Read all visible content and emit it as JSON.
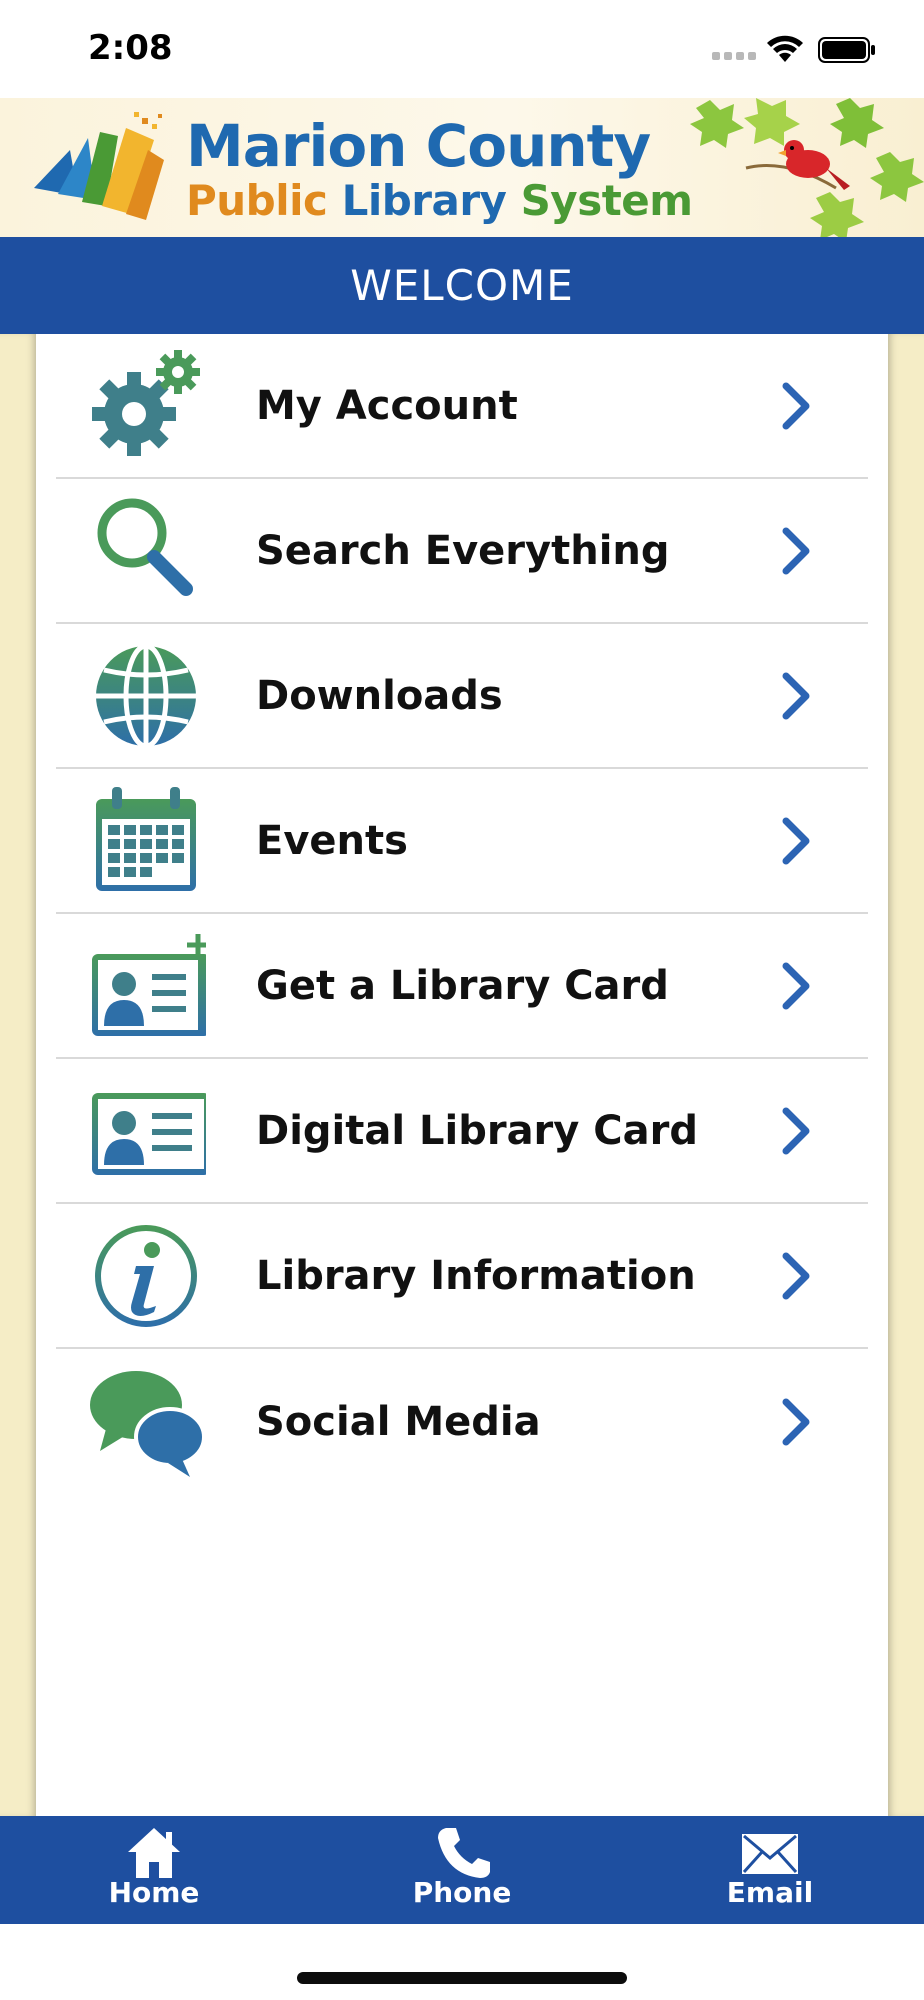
{
  "status_bar": {
    "time": "2:08"
  },
  "header": {
    "logo_line1": "Marion County",
    "logo_line2_word1": "Public",
    "logo_line2_word2": "Library",
    "logo_line2_word3": "System"
  },
  "welcome": {
    "title": "WELCOME"
  },
  "menu": {
    "items": [
      {
        "label": "My Account",
        "icon": "gears-icon"
      },
      {
        "label": "Search Everything",
        "icon": "magnifier-icon"
      },
      {
        "label": "Downloads",
        "icon": "globe-icon"
      },
      {
        "label": "Events",
        "icon": "calendar-icon"
      },
      {
        "label": "Get a Library Card",
        "icon": "add-card-icon"
      },
      {
        "label": "Digital Library Card",
        "icon": "id-card-icon"
      },
      {
        "label": "Library Information",
        "icon": "info-icon"
      },
      {
        "label": "Social Media",
        "icon": "chat-bubbles-icon"
      }
    ]
  },
  "tab_bar": {
    "home": "Home",
    "phone": "Phone",
    "email": "Email"
  },
  "colors": {
    "brand_blue": "#1e4fa0",
    "icon_teal": "#3f7f8a",
    "chevron_blue": "#2c64b4",
    "side_cream": "#f5edc6"
  }
}
